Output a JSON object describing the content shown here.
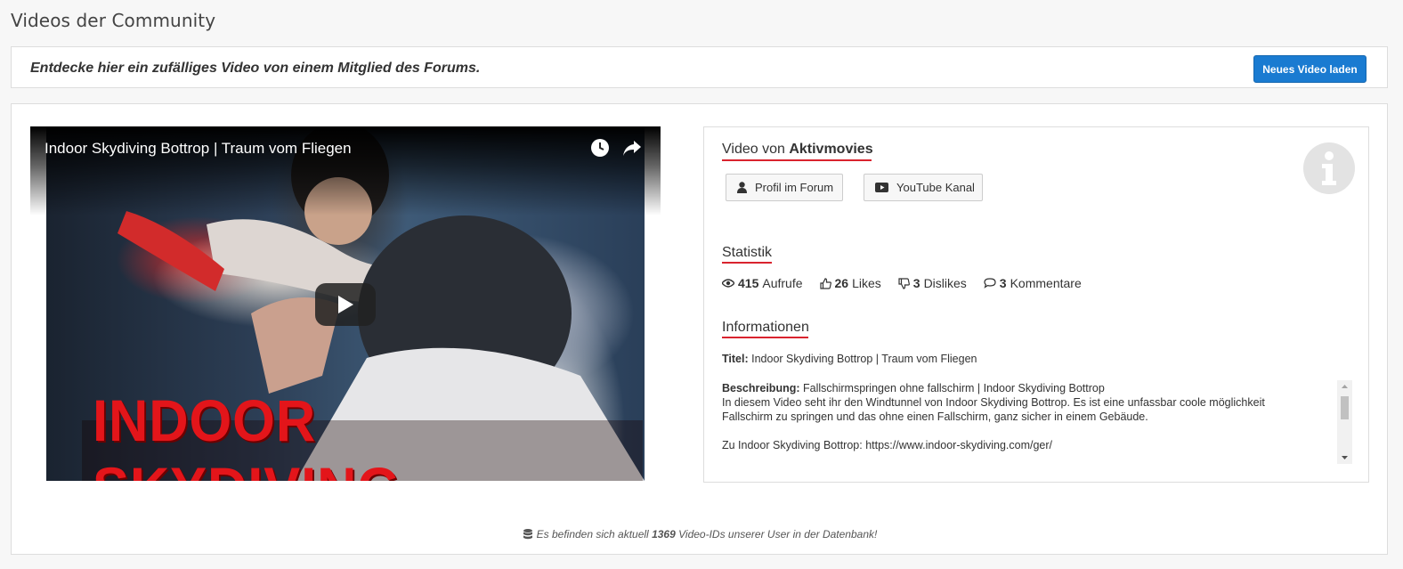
{
  "page": {
    "title": "Videos der Community"
  },
  "intro": {
    "text": "Entdecke hier ein zufälliges Video von einem Mitglied des Forums.",
    "new_video_button": "Neues Video laden"
  },
  "video": {
    "title": "Indoor Skydiving Bottrop | Traum vom Fliegen",
    "thumbnail_text": "INDOOR SKYDIVING",
    "icons": [
      "watch-later-icon",
      "share-icon",
      "play-icon"
    ]
  },
  "info": {
    "uploader_prefix": "Video von",
    "uploader_name": "Aktivmovies",
    "profile_button": "Profil im Forum",
    "youtube_button": "YouTube Kanal",
    "stats_heading": "Statistik",
    "stats": {
      "views_value": "415",
      "views_label": "Aufrufe",
      "likes_value": "26",
      "likes_label": "Likes",
      "dislikes_value": "3",
      "dislikes_label": "Dislikes",
      "comments_value": "3",
      "comments_label": "Kommentare"
    },
    "info_heading": "Informationen",
    "title_label": "Titel:",
    "title_value": "Indoor Skydiving Bottrop | Traum vom Fliegen",
    "desc_label": "Beschreibung:",
    "desc_line1": "Fallschirmspringen ohne fallschirm | Indoor Skydiving Bottrop",
    "desc_line2": "In diesem Video seht ihr den Windtunnel von Indoor Skydiving Bottrop. Es ist eine unfassbar coole möglichkeit",
    "desc_line3": "Fallschirm zu springen und das ohne einen Fallschirm, ganz sicher in einem Gebäude.",
    "desc_line4": "Zu Indoor Skydiving Bottrop: https://www.indoor-skydiving.com/ger/"
  },
  "footer": {
    "prefix": "Es befinden sich aktuell",
    "count": "1369",
    "suffix": "Video-IDs unserer User in der Datenbank!"
  },
  "colors": {
    "accent_red": "#d9232e",
    "button_blue": "#1a7bd1"
  }
}
